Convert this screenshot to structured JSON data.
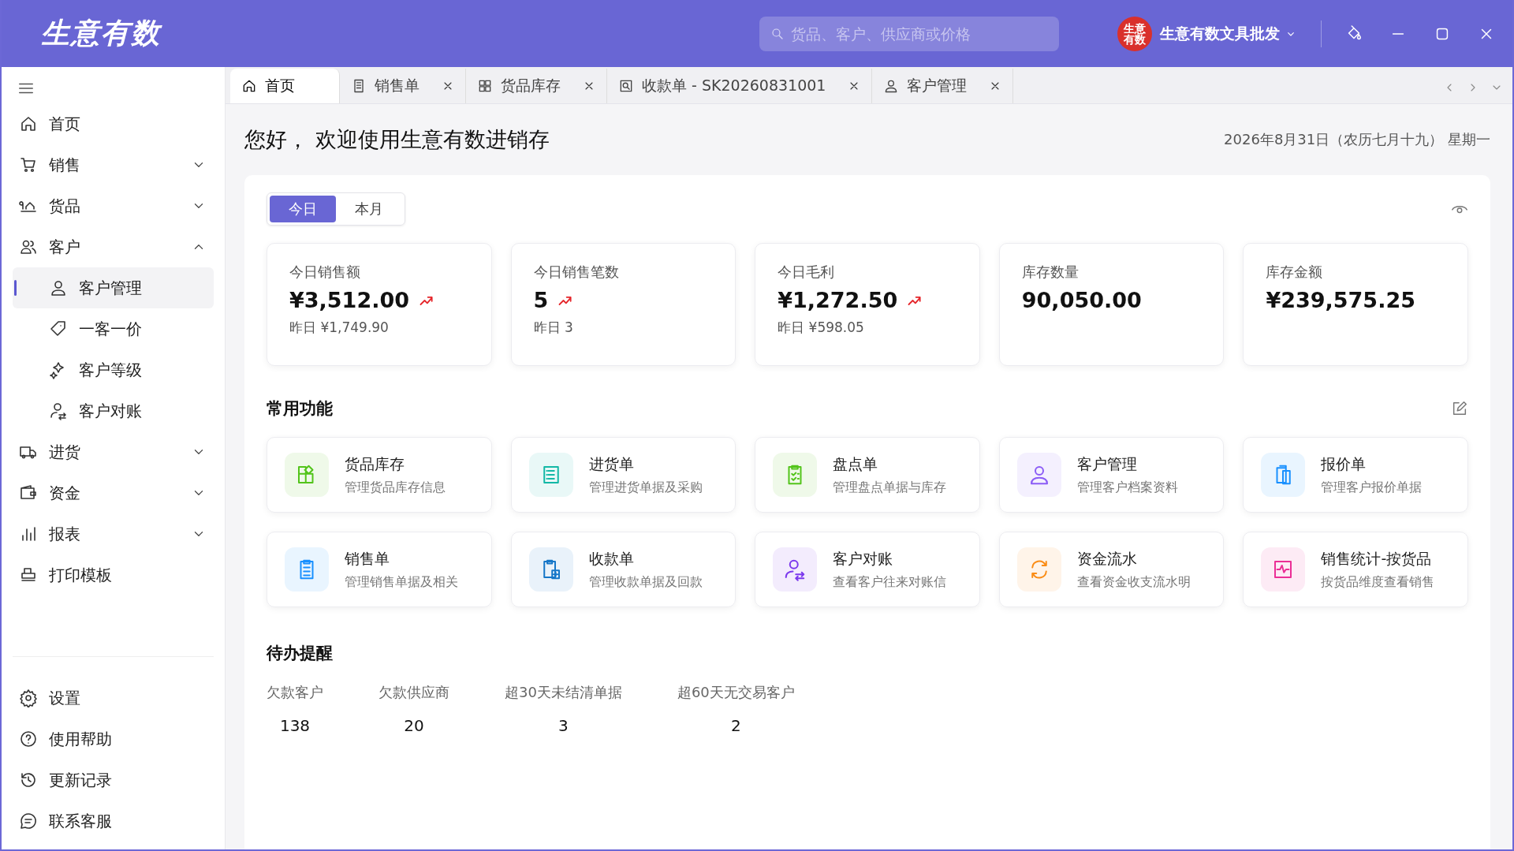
{
  "header": {
    "logo": "生意有数",
    "search": {
      "placeholder": "货品、客户、供应商或价格"
    },
    "avatar_text": "生意有数",
    "shop_name": "生意有数文具批发"
  },
  "tabs": [
    {
      "label": "首页",
      "selected": true,
      "closable": false
    },
    {
      "label": "销售单",
      "selected": false,
      "closable": true
    },
    {
      "label": "货品库存",
      "selected": false,
      "closable": true
    },
    {
      "label": "收款单 - SK20260831001",
      "selected": false,
      "closable": true
    },
    {
      "label": "客户管理",
      "selected": false,
      "closable": true
    }
  ],
  "sidebar": {
    "items": [
      {
        "label": "首页"
      },
      {
        "label": "销售",
        "expanded": false
      },
      {
        "label": "货品",
        "expanded": false
      },
      {
        "label": "客户",
        "expanded": true,
        "children": [
          {
            "label": "客户管理",
            "selected": true
          },
          {
            "label": "一客一价",
            "selected": false
          },
          {
            "label": "客户等级",
            "selected": false
          },
          {
            "label": "客户对账",
            "selected": false
          }
        ]
      },
      {
        "label": "进货",
        "expanded": false
      },
      {
        "label": "资金",
        "expanded": false
      },
      {
        "label": "报表",
        "expanded": false
      },
      {
        "label": "打印模板"
      }
    ],
    "bottom_items": [
      {
        "label": "设置"
      },
      {
        "label": "使用帮助"
      },
      {
        "label": "更新记录"
      },
      {
        "label": "联系客服"
      }
    ]
  },
  "greeting": "您好，  欢迎使用生意有数进销存",
  "date": "2026年8月31日（农历七月十九）  星期一",
  "period_toggle": [
    {
      "label": "今日",
      "selected": true
    },
    {
      "label": "本月",
      "selected": false
    }
  ],
  "stats": [
    {
      "label": "今日销售额",
      "value": "¥3,512.00",
      "trend_up": true,
      "previous": "昨日 ¥1,749.90"
    },
    {
      "label": "今日销售笔数",
      "value": "5",
      "trend_up": true,
      "previous": "昨日 3"
    },
    {
      "label": "今日毛利",
      "value": "¥1,272.50",
      "trend_up": true,
      "previous": "昨日 ¥598.05"
    },
    {
      "label": "库存数量",
      "value": "90,050.00",
      "trend_up": false
    },
    {
      "label": "库存金额",
      "value": "¥239,575.25",
      "trend_up": false
    }
  ],
  "functions_title": "常用功能",
  "functions": [
    {
      "title": "货品库存",
      "description": "管理货品库存信息",
      "color": "#52c41a"
    },
    {
      "title": "进货单",
      "description": "管理进货单据及采购",
      "color": "#13b8a6"
    },
    {
      "title": "盘点单",
      "description": "管理盘点单据与库存",
      "color": "#52c41a"
    },
    {
      "title": "客户管理",
      "description": "管理客户档案资料",
      "color": "#8b5cf6"
    },
    {
      "title": "报价单",
      "description": "管理客户报价单据",
      "color": "#1890ff"
    },
    {
      "title": "销售单",
      "description": "管理销售单据及相关",
      "color": "#1890ff"
    },
    {
      "title": "收款单",
      "description": "管理收款单据及回款",
      "color": "#1677c8"
    },
    {
      "title": "客户对账",
      "description": "查看客户往来对账信",
      "color": "#7c3aed"
    },
    {
      "title": "资金流水",
      "description": "查看资金收支流水明",
      "color": "#fa8c16"
    },
    {
      "title": "销售统计-按货品",
      "description": "按货品维度查看销售",
      "color": "#eb2f96"
    }
  ],
  "todo_title": "待办提醒",
  "todos": [
    {
      "label": "欠款客户",
      "value": "138"
    },
    {
      "label": "欠款供应商",
      "value": "20"
    },
    {
      "label": "超30天未结清单据",
      "value": "3"
    },
    {
      "label": "超60天无交易客户",
      "value": "2"
    }
  ]
}
